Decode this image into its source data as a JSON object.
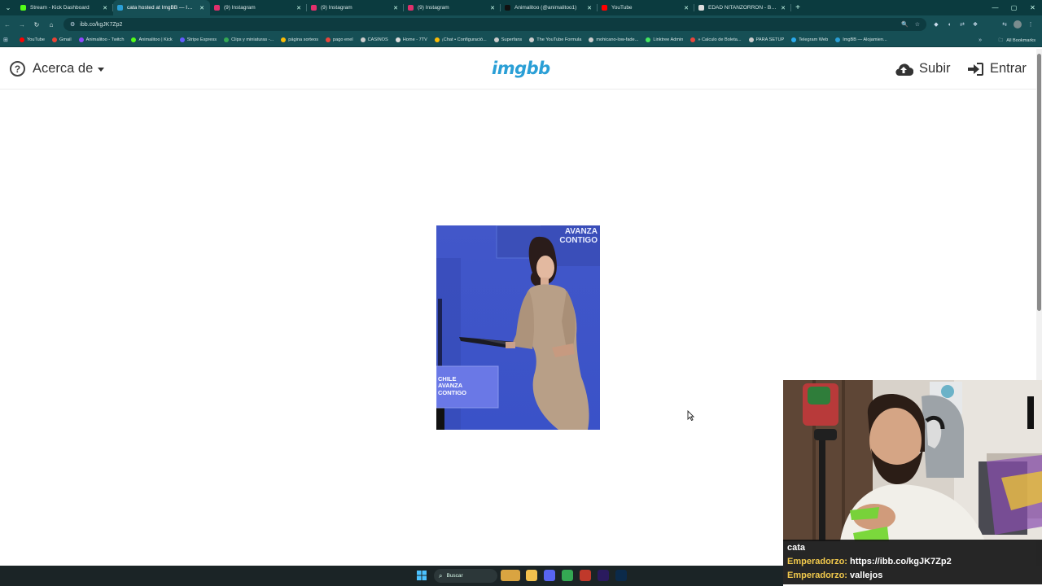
{
  "browser": {
    "tabs": [
      {
        "label": "Stream - Kick Dashboard",
        "color": "#53fc18",
        "active": false
      },
      {
        "label": "cata hosted at ImgBB — ImgBB",
        "color": "#2a9fd6",
        "active": true
      },
      {
        "label": "(9) Instagram",
        "color": "#e1306c",
        "active": false
      },
      {
        "label": "(9) Instagram",
        "color": "#e1306c",
        "active": false
      },
      {
        "label": "(9) Instagram",
        "color": "#e1306c",
        "active": false
      },
      {
        "label": "Animalitoo (@animalitoo1)",
        "color": "#111111",
        "active": false
      },
      {
        "label": "YouTube",
        "color": "#ff0000",
        "active": false
      },
      {
        "label": "EDAD NITANZORRON - Buscar",
        "color": "#dddddd",
        "active": false
      }
    ],
    "new_tab_symbol": "+",
    "url": "ibb.co/kgJK7Zp2",
    "bookmarks": [
      {
        "label": "YouTube",
        "color": "#ff0000"
      },
      {
        "label": "Gmail",
        "color": "#ea4335"
      },
      {
        "label": "Animalitoo - Twitch",
        "color": "#9146ff"
      },
      {
        "label": "Animalitoo | Kick",
        "color": "#53fc18"
      },
      {
        "label": "Stripe Express",
        "color": "#635bff"
      },
      {
        "label": "Clips y miniaturas -...",
        "color": "#34a853"
      },
      {
        "label": "página sorteos",
        "color": "#fbbc05"
      },
      {
        "label": "pago enel",
        "color": "#e8453c"
      },
      {
        "label": "CASINOS",
        "color": "#cccccc"
      },
      {
        "label": "Home - 7TV",
        "color": "#dddddd"
      },
      {
        "label": "¡Chat • Configuració...",
        "color": "#fbbc05"
      },
      {
        "label": "Superfans",
        "color": "#cccccc"
      },
      {
        "label": "The YouTube Formula",
        "color": "#cccccc"
      },
      {
        "label": "mohicano-low-fade...",
        "color": "#cccccc"
      },
      {
        "label": "Linktree Admin",
        "color": "#43e660"
      },
      {
        "label": "» Calculo de Boleta...",
        "color": "#e8453c"
      },
      {
        "label": "PARA SETUP",
        "color": "#cccccc"
      },
      {
        "label": "Telegram Web",
        "color": "#2aabee"
      },
      {
        "label": "ImgBB — Alojamien...",
        "color": "#2a9fd6"
      }
    ],
    "all_bookmarks_label": "All Bookmarks"
  },
  "site": {
    "about_label": "Acerca de",
    "logo_text": "imgbb",
    "upload_label": "Subir",
    "login_label": "Entrar"
  },
  "photo": {
    "banner_top": [
      "AVANZA",
      "CONTIGO"
    ],
    "podium_text": [
      "CHILE",
      "AVANZA",
      "CONTIGO"
    ]
  },
  "chat": {
    "messages": [
      {
        "user": "",
        "text": "cata"
      },
      {
        "user": "Emperadorzo",
        "text": "https://ibb.co/kgJK7Zp2"
      },
      {
        "user": "Emperadorzo",
        "text": "vallejos"
      }
    ]
  },
  "taskbar": {
    "search_placeholder": "Buscar",
    "icons": [
      {
        "name": "weather-icon",
        "color": "#d9a441"
      },
      {
        "name": "file-explorer-icon",
        "color": "#f2c14e"
      },
      {
        "name": "discord-icon",
        "color": "#5865f2"
      },
      {
        "name": "chrome-icon",
        "color": "#34a853"
      },
      {
        "name": "ticket-app-icon",
        "color": "#c0392b"
      },
      {
        "name": "premiere-icon",
        "color": "#2a1a5e"
      },
      {
        "name": "photoshop-icon",
        "color": "#0b2a4a"
      }
    ]
  }
}
